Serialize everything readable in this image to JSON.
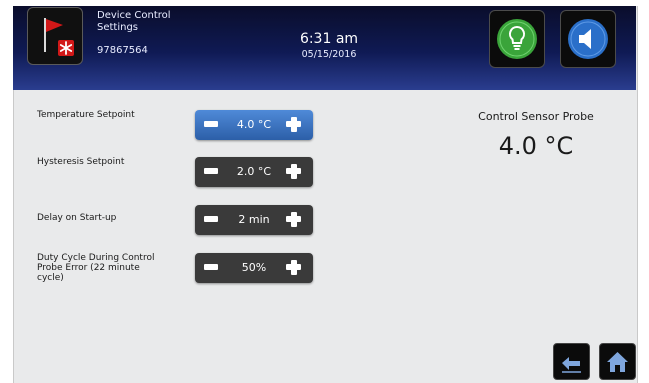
{
  "header": {
    "title": "Device Control Settings",
    "device_id": "97867564",
    "time": "6:31 am",
    "date": "05/15/2016",
    "icons": {
      "alarm": "flag-alarm-icon",
      "light": "lightbulb-icon",
      "sound": "speaker-icon"
    },
    "colors": {
      "header_dark": "#0a0d2b",
      "header_light": "#2a3d8f",
      "light_green": "#3aa43a",
      "sound_blue": "#2a6fc9"
    }
  },
  "settings": [
    {
      "label": "Temperature Setpoint",
      "value": "4.0 °C",
      "active": true
    },
    {
      "label": "Hysteresis Setpoint",
      "value": "2.0 °C",
      "active": false
    },
    {
      "label": "Delay on Start-up",
      "value": "2 min",
      "active": false
    },
    {
      "label": "Duty Cycle During Control Probe Error (22 minute cycle)",
      "value": "50%",
      "active": false
    }
  ],
  "sensor": {
    "title": "Control Sensor Probe",
    "value": "4.0 °C"
  },
  "nav": {
    "back_icon": "back-arrow-icon",
    "home_icon": "home-icon"
  },
  "colors": {
    "active_ctrl": "#3b74c4",
    "inactive_ctrl": "#3a3a3a"
  }
}
